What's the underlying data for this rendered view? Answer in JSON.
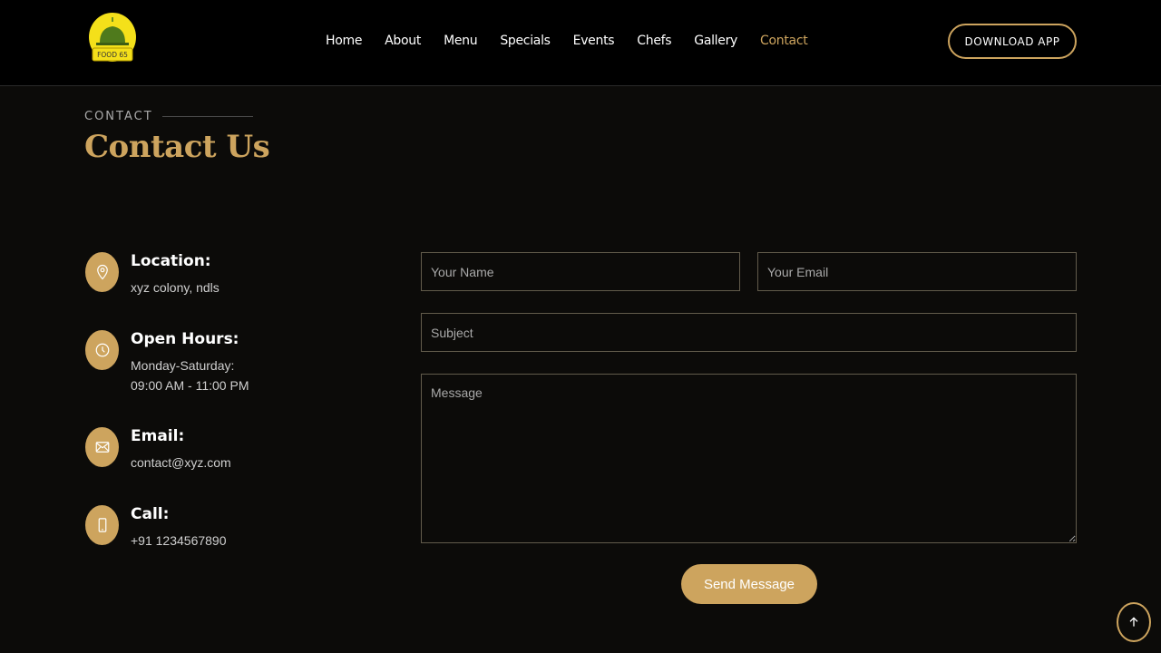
{
  "brand": {
    "logo_text": "FOOD 65",
    "colors": {
      "accent": "#cda45e",
      "logo_yellow": "#f4e01a",
      "background": "#0c0b09"
    }
  },
  "nav": {
    "items": [
      {
        "label": "Home",
        "active": false
      },
      {
        "label": "About",
        "active": false
      },
      {
        "label": "Menu",
        "active": false
      },
      {
        "label": "Specials",
        "active": false
      },
      {
        "label": "Events",
        "active": false
      },
      {
        "label": "Chefs",
        "active": false
      },
      {
        "label": "Gallery",
        "active": false
      },
      {
        "label": "Contact",
        "active": true
      }
    ],
    "download_label": "DOWNLOAD APP"
  },
  "contact": {
    "section_tag": "CONTACT",
    "title": "Contact Us",
    "info": [
      {
        "icon": "map-pin-icon",
        "title": "Location:",
        "lines": [
          "xyz colony, ndls"
        ]
      },
      {
        "icon": "clock-icon",
        "title": "Open Hours:",
        "lines": [
          "Monday-Saturday:",
          "09:00 AM - 11:00 PM"
        ]
      },
      {
        "icon": "envelope-icon",
        "title": "Email:",
        "lines": [
          "contact@xyz.com"
        ]
      },
      {
        "icon": "phone-icon",
        "title": "Call:",
        "lines": [
          "+91 1234567890"
        ]
      }
    ]
  },
  "form": {
    "name_placeholder": "Your Name",
    "email_placeholder": "Your Email",
    "subject_placeholder": "Subject",
    "message_placeholder": "Message",
    "submit_label": "Send Message"
  },
  "back_to_top": {
    "icon": "arrow-up-icon"
  }
}
